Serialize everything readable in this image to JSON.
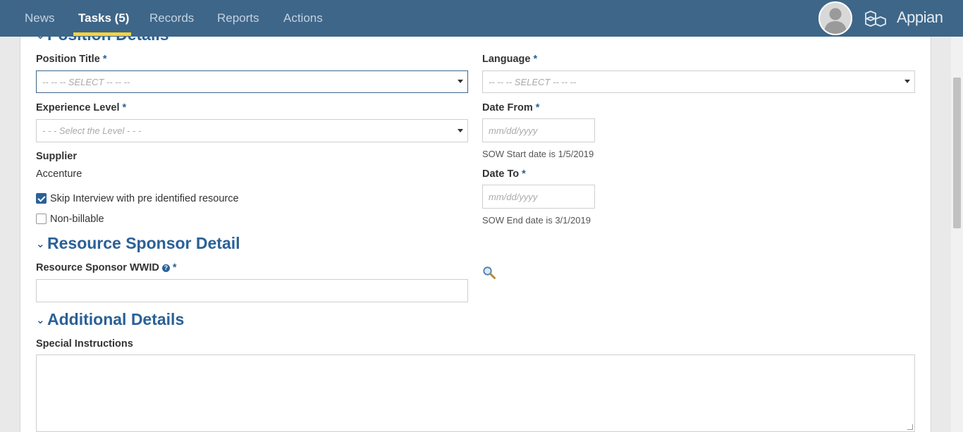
{
  "nav": {
    "tabs": [
      {
        "label": "News"
      },
      {
        "label": "Tasks (5)"
      },
      {
        "label": "Records"
      },
      {
        "label": "Reports"
      },
      {
        "label": "Actions"
      }
    ],
    "active_tab": "Tasks (5)",
    "brand": "Appian",
    "accent_color": "#f3d33c",
    "bar_color": "#3e6688"
  },
  "sections": {
    "position": {
      "title": "Position Details"
    },
    "sponsor": {
      "title": "Resource Sponsor Detail"
    },
    "additional": {
      "title": "Additional Details"
    }
  },
  "form": {
    "position_title": {
      "label": "Position Title",
      "required": "*",
      "placeholder": "-- -- -- SELECT -- -- --"
    },
    "language": {
      "label": "Language",
      "required": "*",
      "placeholder": "-- -- -- SELECT -- -- --"
    },
    "experience_level": {
      "label": "Experience Level",
      "required": "*",
      "placeholder": "- - - Select the Level - - -"
    },
    "date_from": {
      "label": "Date From",
      "required": "*",
      "placeholder": "mm/dd/yyyy",
      "helper": "SOW Start date is 1/5/2019"
    },
    "date_to": {
      "label": "Date To",
      "required": "*",
      "placeholder": "mm/dd/yyyy",
      "helper": "SOW End date is 3/1/2019"
    },
    "supplier": {
      "label": "Supplier",
      "value": "Accenture"
    },
    "skip_interview": {
      "label": "Skip Interview with pre identified resource",
      "checked": true
    },
    "non_billable": {
      "label": "Non-billable",
      "checked": false
    },
    "sponsor_wwid": {
      "label": "Resource Sponsor WWID",
      "help_icon": "?",
      "required": "*",
      "value": ""
    },
    "special_instructions": {
      "label": "Special Instructions",
      "value": ""
    }
  },
  "icons": {
    "search": "magnifier-icon",
    "chevron": "chevron-down-icon"
  }
}
